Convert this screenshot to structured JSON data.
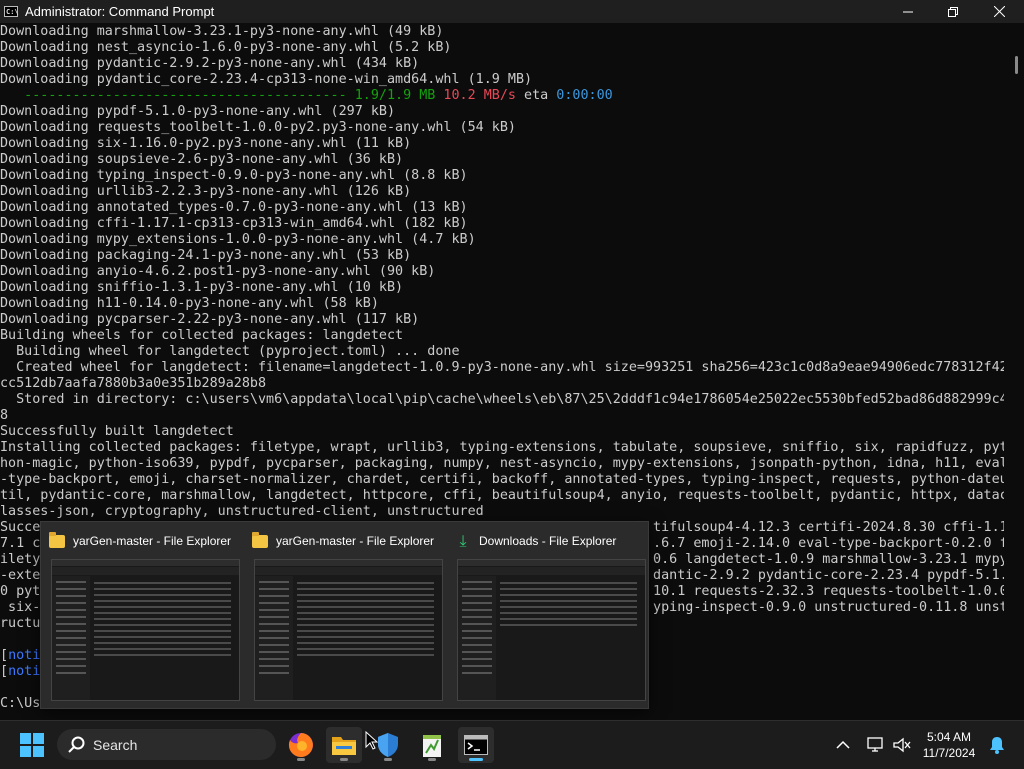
{
  "window": {
    "title": "Administrator: Command Prompt"
  },
  "console_lines": [
    [
      {
        "t": "Downloading marshmallow-3.23.1-py3-none-any.whl (49 kB)"
      }
    ],
    [
      {
        "t": "Downloading nest_asyncio-1.6.0-py3-none-any.whl (5.2 kB)"
      }
    ],
    [
      {
        "t": "Downloading pydantic-2.9.2-py3-none-any.whl (434 kB)"
      }
    ],
    [
      {
        "t": "Downloading pydantic_core-2.23.4-cp313-none-win_amd64.whl (1.9 MB)"
      }
    ],
    [
      {
        "t": "   ---------------------------------------- ",
        "c": "g"
      },
      {
        "t": "1.9/1.9 MB",
        "c": "g"
      },
      {
        "t": " "
      },
      {
        "t": "10.2 MB/s",
        "c": "r"
      },
      {
        "t": " eta "
      },
      {
        "t": "0:00:00",
        "c": "c"
      }
    ],
    [
      {
        "t": "Downloading pypdf-5.1.0-py3-none-any.whl (297 kB)"
      }
    ],
    [
      {
        "t": "Downloading requests_toolbelt-1.0.0-py2.py3-none-any.whl (54 kB)"
      }
    ],
    [
      {
        "t": "Downloading six-1.16.0-py2.py3-none-any.whl (11 kB)"
      }
    ],
    [
      {
        "t": "Downloading soupsieve-2.6-py3-none-any.whl (36 kB)"
      }
    ],
    [
      {
        "t": "Downloading typing_inspect-0.9.0-py3-none-any.whl (8.8 kB)"
      }
    ],
    [
      {
        "t": "Downloading urllib3-2.2.3-py3-none-any.whl (126 kB)"
      }
    ],
    [
      {
        "t": "Downloading annotated_types-0.7.0-py3-none-any.whl (13 kB)"
      }
    ],
    [
      {
        "t": "Downloading cffi-1.17.1-cp313-cp313-win_amd64.whl (182 kB)"
      }
    ],
    [
      {
        "t": "Downloading mypy_extensions-1.0.0-py3-none-any.whl (4.7 kB)"
      }
    ],
    [
      {
        "t": "Downloading packaging-24.1-py3-none-any.whl (53 kB)"
      }
    ],
    [
      {
        "t": "Downloading anyio-4.6.2.post1-py3-none-any.whl (90 kB)"
      }
    ],
    [
      {
        "t": "Downloading sniffio-1.3.1-py3-none-any.whl (10 kB)"
      }
    ],
    [
      {
        "t": "Downloading h11-0.14.0-py3-none-any.whl (58 kB)"
      }
    ],
    [
      {
        "t": "Downloading pycparser-2.22-py3-none-any.whl (117 kB)"
      }
    ],
    [
      {
        "t": "Building wheels for collected packages: langdetect"
      }
    ],
    [
      {
        "t": "  Building wheel for langdetect (pyproject.toml) ... done"
      }
    ],
    [
      {
        "t": "  Created wheel for langdetect: filename=langdetect-1.0.9-py3-none-any.whl size=993251 sha256=423c1c0d8a9eae94906edc778312f42"
      }
    ],
    [
      {
        "t": "cc512db7aafa7880b3a0e351b289a28b8"
      }
    ],
    [
      {
        "t": "  Stored in directory: c:\\users\\vm6\\appdata\\local\\pip\\cache\\wheels\\eb\\87\\25\\2dddf1c94e1786054e25022ec5530bfed52bad86d882999c4"
      }
    ],
    [
      {
        "t": "8"
      }
    ],
    [
      {
        "t": "Successfully built langdetect"
      }
    ],
    [
      {
        "t": "Installing collected packages: filetype, wrapt, urllib3, typing-extensions, tabulate, soupsieve, sniffio, six, rapidfuzz, pyt"
      }
    ],
    [
      {
        "t": "hon-magic, python-iso639, pypdf, pycparser, packaging, numpy, nest-asyncio, mypy-extensions, jsonpath-python, idna, h11, eval"
      }
    ],
    [
      {
        "t": "-type-backport, emoji, charset-normalizer, chardet, certifi, backoff, annotated-types, typing-inspect, requests, python-dateu"
      }
    ],
    [
      {
        "t": "til, pydantic-core, marshmallow, langdetect, httpcore, cffi, beautifulsoup4, anyio, requests-toolbelt, pydantic, httpx, datac"
      }
    ],
    [
      {
        "t": "lasses-json, cryptography, unstructured-client, unstructured"
      }
    ],
    [
      {
        "t": "Succe                                                                            tifulsoup4-4.12.3 certifi-2024.8.30 cffi-1.1"
      }
    ],
    [
      {
        "t": "7.1 c                                                                            .6.7 emoji-2.14.0 eval-type-backport-0.2.0 f"
      }
    ],
    [
      {
        "t": "ilety                                                                            0.6 langdetect-1.0.9 marshmallow-3.23.1 mypy"
      }
    ],
    [
      {
        "t": "-exte                                                                            dantic-2.9.2 pydantic-core-2.23.4 pypdf-5.1."
      }
    ],
    [
      {
        "t": "0 pyt                                                                            10.1 requests-2.32.3 requests-toolbelt-1.0.0"
      }
    ],
    [
      {
        "t": " six-                                                                            yping-inspect-0.9.0 unstructured-0.11.8 unst"
      }
    ],
    [
      {
        "t": "ructu"
      }
    ],
    [
      {
        "t": ""
      }
    ],
    [
      {
        "t": "["
      },
      {
        "t": "noti",
        "c": "n"
      }
    ],
    [
      {
        "t": "["
      },
      {
        "t": "noti",
        "c": "n"
      }
    ],
    [
      {
        "t": ""
      }
    ],
    [
      {
        "t": "C:\\Us"
      }
    ]
  ],
  "previews": [
    {
      "title": "yarGen-master - File Explorer",
      "icon": "folder-icon"
    },
    {
      "title": "yarGen-master - File Explorer",
      "icon": "folder-icon"
    },
    {
      "title": "Downloads - File Explorer",
      "icon": "download-icon"
    }
  ],
  "taskbar": {
    "search_label": "Search",
    "time": "5:04 AM",
    "date": "11/7/2024",
    "apps": [
      "firefox-icon",
      "file-explorer-icon",
      "defender-icon",
      "notepad-plus-icon",
      "terminal-icon"
    ]
  }
}
